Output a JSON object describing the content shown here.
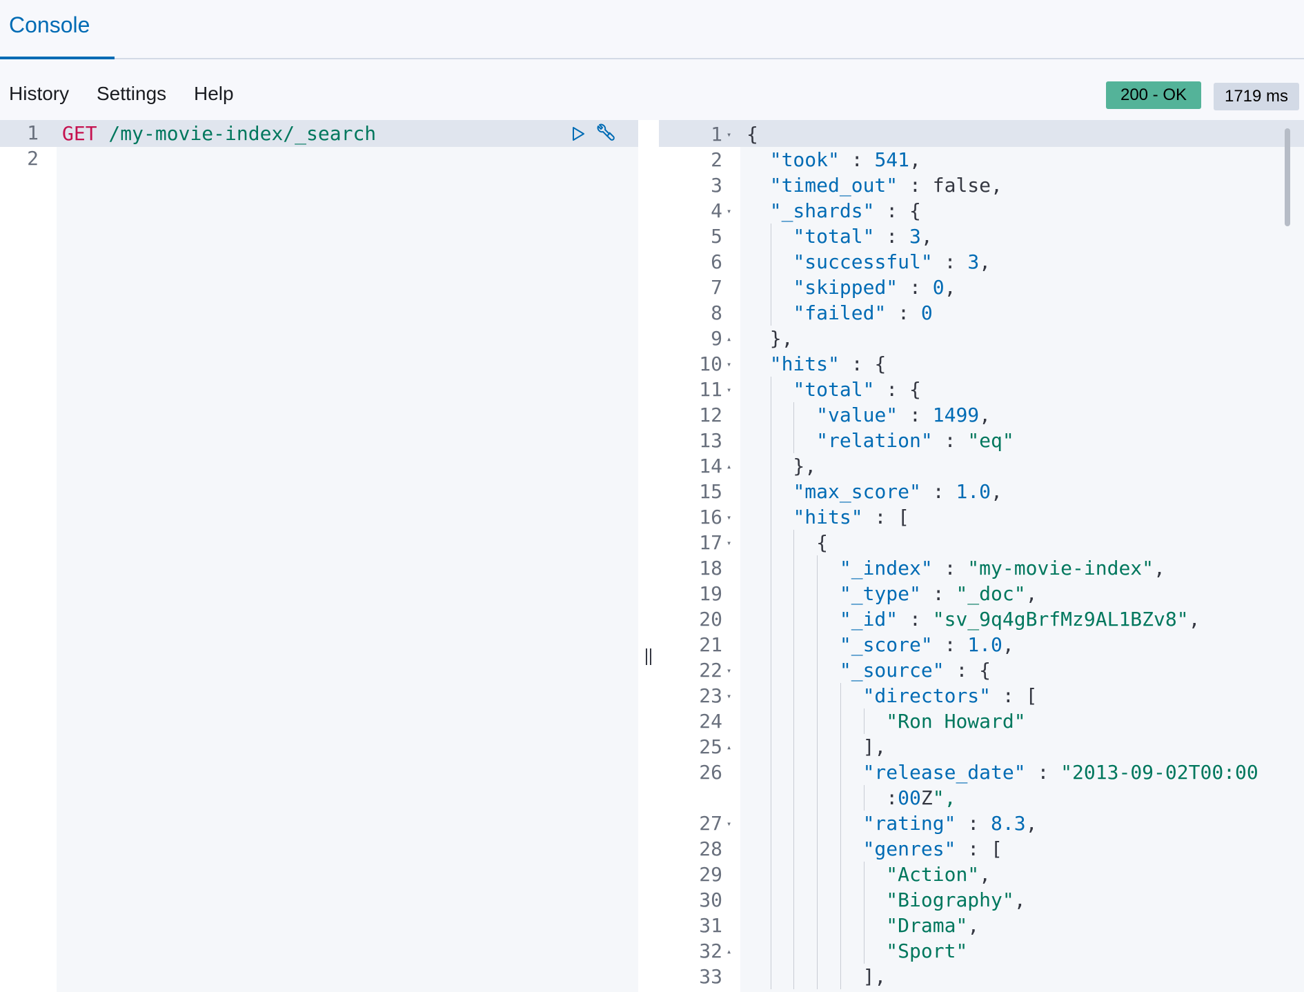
{
  "tabs": [
    {
      "label": "Console",
      "active": true
    }
  ],
  "menu": {
    "history": "History",
    "settings": "Settings",
    "help": "Help"
  },
  "response_status": {
    "status": "200 - OK",
    "time": "1719 ms",
    "status_color": "#54b399"
  },
  "request_editor": {
    "line_numbers": [
      "1",
      "2"
    ],
    "method": "GET",
    "url": " /my-movie-index/_search",
    "icons": [
      "play-icon",
      "wrench-icon"
    ]
  },
  "response_editor": {
    "line_numbers": [
      "1",
      "2",
      "3",
      "4",
      "5",
      "6",
      "7",
      "8",
      "9",
      "10",
      "11",
      "12",
      "13",
      "14",
      "15",
      "16",
      "17",
      "18",
      "19",
      "20",
      "21",
      "22",
      "23",
      "24",
      "25",
      "26",
      "27",
      "28",
      "29",
      "30",
      "31",
      "32",
      "33"
    ],
    "lines": [
      "{",
      "  \"took\" : 541,",
      "  \"timed_out\" : false,",
      "  \"_shards\" : {",
      "    \"total\" : 3,",
      "    \"successful\" : 3,",
      "    \"skipped\" : 0,",
      "    \"failed\" : 0",
      "  },",
      "  \"hits\" : {",
      "    \"total\" : {",
      "      \"value\" : 1499,",
      "      \"relation\" : \"eq\"",
      "    },",
      "    \"max_score\" : 1.0,",
      "    \"hits\" : [",
      "      {",
      "        \"_index\" : \"my-movie-index\",",
      "        \"_type\" : \"_doc\",",
      "        \"_id\" : \"sv_9q4gBrfMz9AL1BZv8\",",
      "        \"_score\" : 1.0,",
      "        \"_source\" : {",
      "          \"directors\" : [",
      "            \"Ron Howard\"",
      "          ],",
      "          \"release_date\" : \"2013-09-02T00:00",
      "            :00Z\",",
      "          \"rating\" : 8.3,",
      "          \"genres\" : [",
      "            \"Action\",",
      "            \"Biography\",",
      "            \"Drama\",",
      "            \"Sport\"",
      "          ],"
    ]
  }
}
